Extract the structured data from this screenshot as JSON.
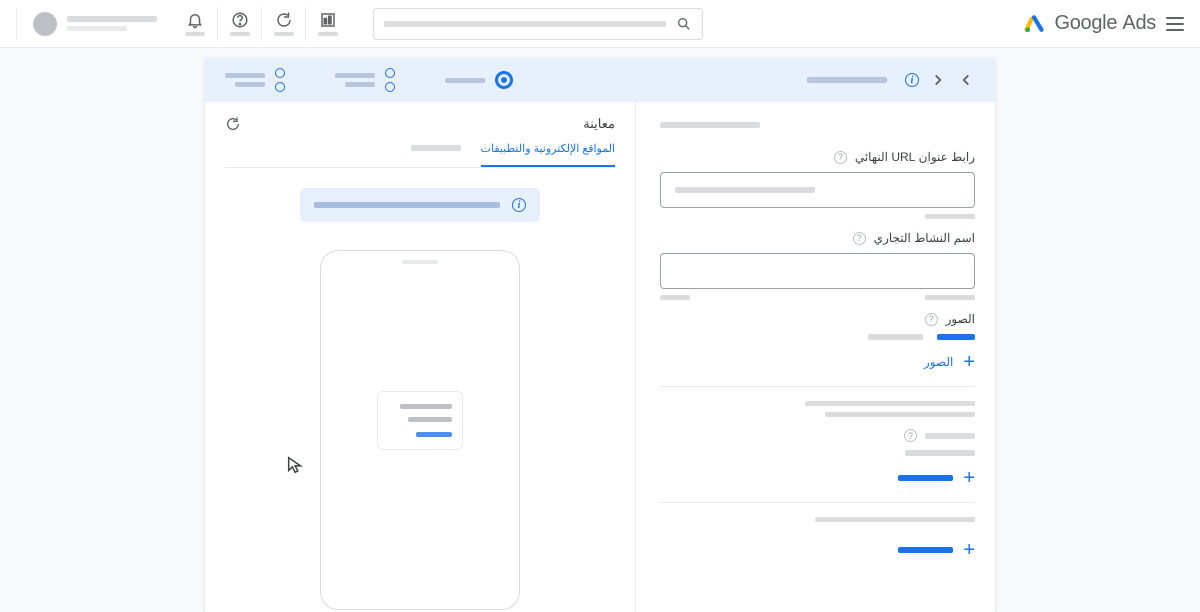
{
  "brand": {
    "name1": "Google",
    "name2": "Ads"
  },
  "form": {
    "url_label": "رابط عنوان URL النهائي",
    "business_label": "اسم النشاط التجاري",
    "images_label": "الصور",
    "add_images": "الصور"
  },
  "preview": {
    "title": "معاينة",
    "tab_web": "المواقع الإلكترونية والتطبيقات"
  }
}
